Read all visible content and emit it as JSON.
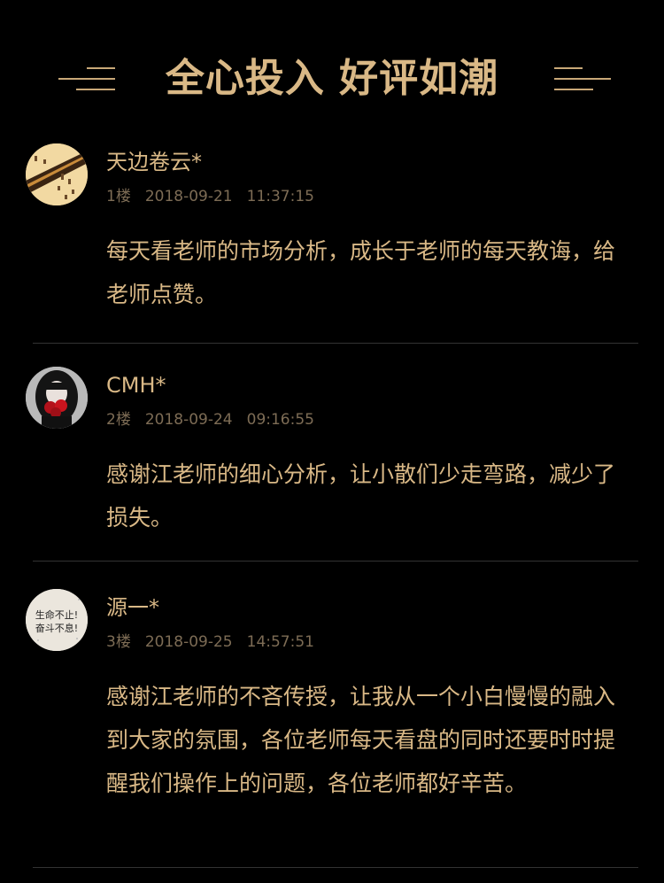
{
  "header": {
    "title": "全心投入 好评如潮"
  },
  "comments": [
    {
      "avatar": "calligraphy-avatar",
      "name": "天边卷云*",
      "floor": "1楼",
      "date": "2018-09-21",
      "time": "11:37:15",
      "text": "每天看老师的市场分析，成长于老师的每天教诲，给老师点赞。"
    },
    {
      "avatar": "girl-roses-avatar",
      "name": "CMH*",
      "floor": "2楼",
      "date": "2018-09-24",
      "time": "09:16:55",
      "text": "感谢江老师的细心分析，让小散们少走弯路，减少了损失。"
    },
    {
      "avatar": "motto-avatar",
      "avatar_text": [
        "生命不止!",
        "奋斗不息!"
      ],
      "name": "源一*",
      "floor": "3楼",
      "date": "2018-09-25",
      "time": "14:57:51",
      "text": "感谢江老师的不吝传授，让我从一个小白慢慢的融入到大家的氛围，各位老师每天看盘的同时还要时时提醒我们操作上的问题，各位老师都好辛苦。"
    }
  ],
  "colors": {
    "background": "#000000",
    "accent_gold": "#d9b886",
    "meta_gray": "#7d6c55",
    "divider": "#333333"
  }
}
